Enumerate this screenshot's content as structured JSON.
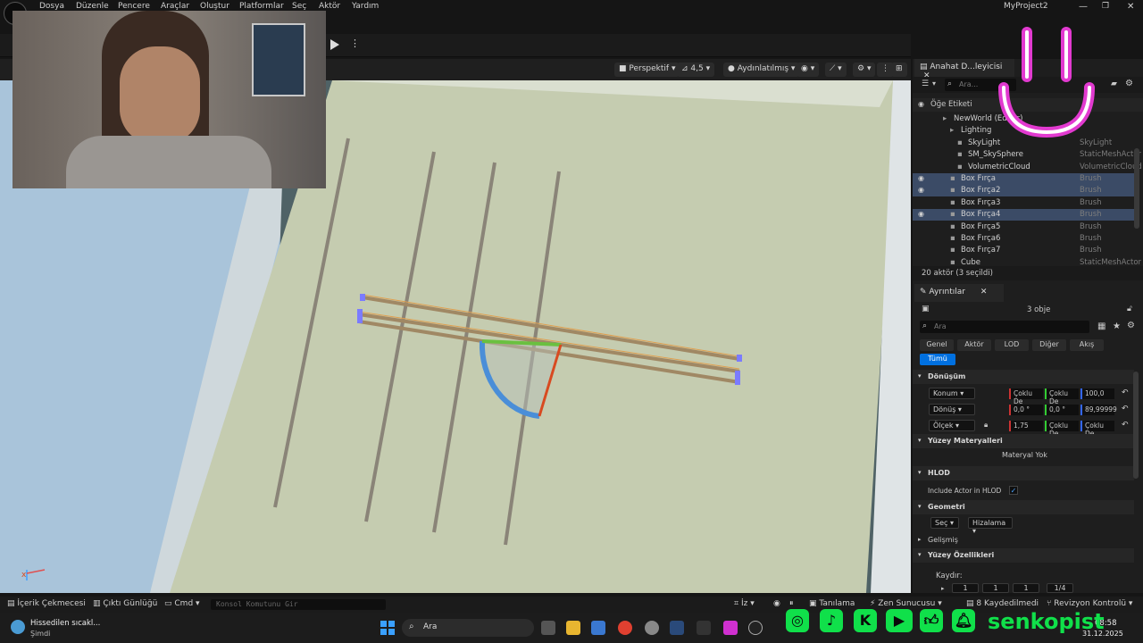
{
  "menu": [
    "Dosya",
    "Düzenle",
    "Pencere",
    "Araçlar",
    "Oluştur",
    "Platformlar",
    "Seç",
    "Aktör",
    "Yardım"
  ],
  "window_title": "MyProject2",
  "viewport": {
    "mode": "Perspektif",
    "fov": "4,5",
    "lighting": "Aydınlatılmış"
  },
  "outliner": {
    "tab": "Anahat D...leyicisi",
    "search_placeholder": "Ara...",
    "column_label": "Öğe Etiketi",
    "rows": [
      {
        "label": "NewWorld (Editor)",
        "type": "",
        "indent": 46,
        "selected": false,
        "eye": false
      },
      {
        "label": "Lighting",
        "type": "",
        "indent": 54,
        "selected": false,
        "eye": false
      },
      {
        "label": "SkyLight",
        "type": "SkyLight",
        "indent": 62,
        "selected": false,
        "eye": false
      },
      {
        "label": "SM_SkySphere",
        "type": "StaticMeshActor",
        "indent": 62,
        "selected": false,
        "eye": false
      },
      {
        "label": "VolumetricCloud",
        "type": "VolumetricCloud",
        "indent": 62,
        "selected": false,
        "eye": false
      },
      {
        "label": "Box Fırça",
        "type": "Brush",
        "indent": 54,
        "selected": true,
        "eye": true
      },
      {
        "label": "Box Fırça2",
        "type": "Brush",
        "indent": 54,
        "selected": true,
        "eye": true
      },
      {
        "label": "Box Fırça3",
        "type": "Brush",
        "indent": 54,
        "selected": false,
        "eye": false
      },
      {
        "label": "Box Fırça4",
        "type": "Brush",
        "indent": 54,
        "selected": true,
        "eye": true
      },
      {
        "label": "Box Fırça5",
        "type": "Brush",
        "indent": 54,
        "selected": false,
        "eye": false
      },
      {
        "label": "Box Fırça6",
        "type": "Brush",
        "indent": 54,
        "selected": false,
        "eye": false
      },
      {
        "label": "Box Fırça7",
        "type": "Brush",
        "indent": 54,
        "selected": false,
        "eye": false
      },
      {
        "label": "Cube",
        "type": "StaticMeshActor",
        "indent": 54,
        "selected": false,
        "eye": false
      }
    ],
    "count": "20 aktör (3 seçildi)"
  },
  "details": {
    "tab": "Ayrıntılar",
    "object_count": "3 obje",
    "search_placeholder": "Ara",
    "categories": [
      "Genel",
      "Aktör",
      "LOD",
      "Diğer",
      "Akış"
    ],
    "all_label": "Tümü",
    "transform_label": "Dönüşüm",
    "location_label": "Konum",
    "location": [
      "Çoklu De",
      "Çoklu De",
      "100,0"
    ],
    "rotation_label": "Dönüş",
    "rotation": [
      "0,0 °",
      "0,0 °",
      "89,99999"
    ],
    "scale_label": "Ölçek",
    "scale": [
      "1,75",
      "Çoklu De",
      "Çoklu De"
    ],
    "materials_label": "Yüzey Materyalleri",
    "no_material": "Materyal Yok",
    "hlod_label": "HLOD",
    "include_hlod": "Include Actor in HLOD",
    "geometry_label": "Geometri",
    "select_label": "Seç",
    "align_label": "Hizalama",
    "advanced_label": "Gelişmiş",
    "surface_label": "Yüzey Özellikleri",
    "pan_label": "Kaydır:",
    "pan_values": [
      "1",
      "1",
      "1",
      "1/4"
    ]
  },
  "statusbar": {
    "content_drawer": "İçerik Çekmecesi",
    "output_log": "Çıktı Günlüğü",
    "cmd": "Cmd",
    "console_placeholder": "Konsol Komutunu Gir",
    "trace": "İz",
    "derive": "Tanılama",
    "zen": "Zen Sunucusu",
    "unsaved": "8 Kaydedilmedi",
    "revision": "Revizyon Kontrolü"
  },
  "taskbar": {
    "weather_title": "Hissedilen sıcakl...",
    "weather_sub": "Şimdi",
    "search": "Ara",
    "time": "08:58",
    "date": "31.12.2025",
    "streamer": "senkopist"
  },
  "colors": {
    "accent_blue": "#0070e0",
    "selection": "#3b4b66",
    "neon_pink": "#e23ad0",
    "social_green": "#10e04a"
  }
}
